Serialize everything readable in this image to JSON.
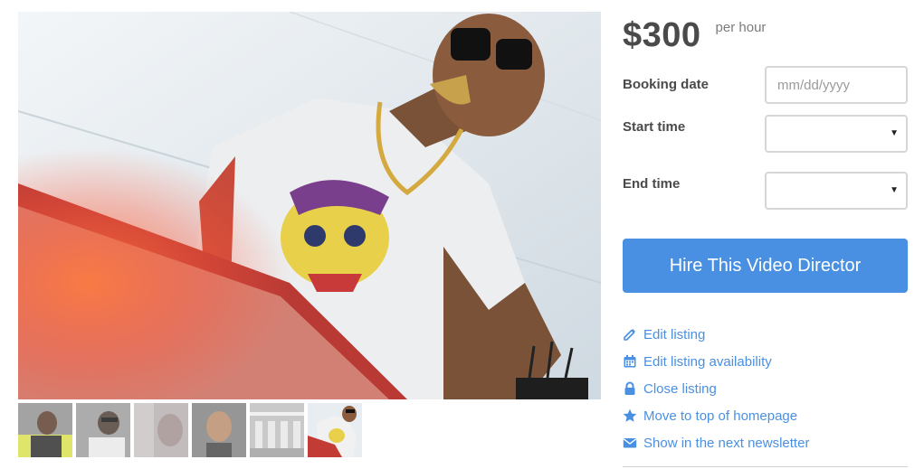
{
  "listing": {
    "price": "$300",
    "price_unit": "per hour"
  },
  "booking": {
    "date_label": "Booking date",
    "date_placeholder": "mm/dd/yyyy",
    "start_label": "Start time",
    "start_value": "",
    "end_label": "End time",
    "end_value": "",
    "hire_button": "Hire This Video Director"
  },
  "actions": [
    {
      "label": "Edit listing",
      "icon": "pencil-icon"
    },
    {
      "label": "Edit listing availability",
      "icon": "calendar-icon"
    },
    {
      "label": "Close listing",
      "icon": "lock-icon"
    },
    {
      "label": "Move to top of homepage",
      "icon": "star-icon"
    },
    {
      "label": "Show in the next newsletter",
      "icon": "envelope-icon"
    }
  ],
  "gallery": {
    "thumbnail_count": 6,
    "selected_index": 5
  },
  "colors": {
    "accent": "#4a90e2",
    "text": "#4a4a4a",
    "muted": "#7b7b7b",
    "border": "#d6d6d6"
  }
}
